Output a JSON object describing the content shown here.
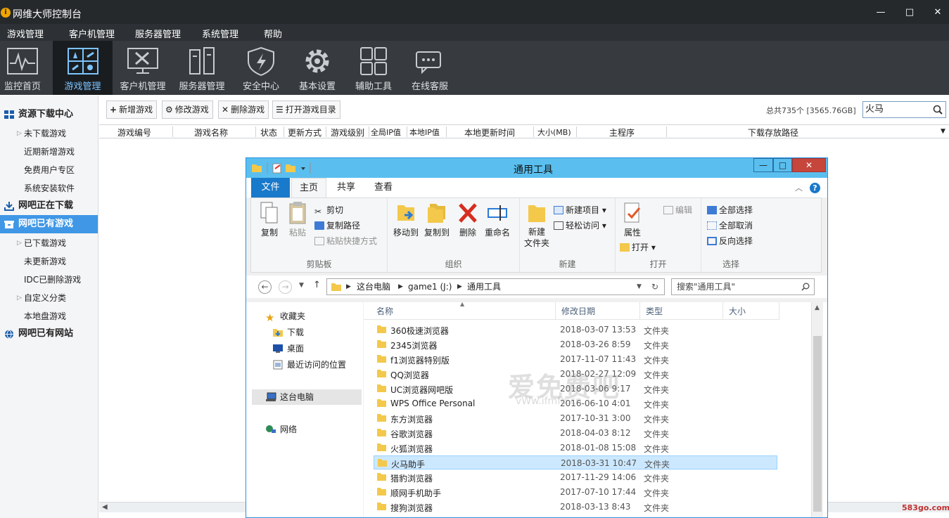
{
  "app": {
    "title": "网维大师控制台",
    "window_buttons": [
      "—",
      "□",
      "✕"
    ]
  },
  "menu": [
    "游戏管理",
    "客户机管理",
    "服务器管理",
    "系统管理",
    "帮助"
  ],
  "toolbar": [
    {
      "label": "监控首页",
      "icon": "monitor-pulse-icon"
    },
    {
      "label": "游戏管理",
      "icon": "game-pieces-icon",
      "active": true
    },
    {
      "label": "客户机管理",
      "icon": "client-tools-icon"
    },
    {
      "label": "服务器管理",
      "icon": "server-rack-icon"
    },
    {
      "label": "安全中心",
      "icon": "shield-icon"
    },
    {
      "label": "基本设置",
      "icon": "gear-icon"
    },
    {
      "label": "辅助工具",
      "icon": "grid-tools-icon"
    },
    {
      "label": "在线客服",
      "icon": "chat-icon"
    }
  ],
  "sidebar": {
    "items": [
      {
        "label": "资源下载中心",
        "group": true,
        "icon": "grid-icon"
      },
      {
        "label": "未下载游戏",
        "arrow": true
      },
      {
        "label": "近期新增游戏"
      },
      {
        "label": "免费用户专区"
      },
      {
        "label": "系统安装软件"
      },
      {
        "label": "网吧正在下载",
        "group": true,
        "icon": "download-icon"
      },
      {
        "label": "网吧已有游戏",
        "group": true,
        "icon": "box-icon",
        "selected": true
      },
      {
        "label": "已下载游戏",
        "arrow": true
      },
      {
        "label": "未更新游戏"
      },
      {
        "label": "IDC已删除游戏"
      },
      {
        "label": "自定义分类",
        "arrow": true
      },
      {
        "label": "本地盘游戏"
      },
      {
        "label": "网吧已有网站",
        "group": true,
        "icon": "globe-icon"
      }
    ]
  },
  "actions": {
    "add": "新增游戏",
    "edit": "修改游戏",
    "delete": "删除游戏",
    "open_dir": "打开游戏目录"
  },
  "summary": "总共735个 [3565.76GB]",
  "search": {
    "value": "火马"
  },
  "columns": [
    "游戏编号",
    "游戏名称",
    "状态",
    "更新方式",
    "游戏级别",
    "全局IP值",
    "本地IP值",
    "本地更新时间",
    "大小(MB)",
    "主程序",
    "下载存放路径"
  ],
  "explorer": {
    "title": "通用工具",
    "tabs": [
      "文件",
      "主页",
      "共享",
      "查看"
    ],
    "ribbon": {
      "clipboard": {
        "label": "剪贴板",
        "copy": "复制",
        "paste": "粘贴",
        "cut": "剪切",
        "copy_path": "复制路径",
        "paste_shortcut": "粘贴快捷方式"
      },
      "organize": {
        "label": "组织",
        "move_to": "移动到",
        "copy_to": "复制到",
        "delete": "删除",
        "rename": "重命名"
      },
      "new": {
        "label": "新建",
        "new_folder": "新建\n文件夹",
        "new_item": "新建项目",
        "easy_access": "轻松访问"
      },
      "open": {
        "label": "打开",
        "properties": "属性",
        "open": "打开",
        "edit": "编辑"
      },
      "select": {
        "label": "选择",
        "select_all": "全部选择",
        "select_none": "全部取消",
        "invert": "反向选择"
      }
    },
    "address": [
      "这台电脑",
      "game1 (J:)",
      "通用工具"
    ],
    "search_placeholder": "搜索\"通用工具\"",
    "nav": [
      {
        "label": "收藏夹",
        "icon": "star-icon"
      },
      {
        "label": "下载",
        "icon": "download-folder-icon"
      },
      {
        "label": "桌面",
        "icon": "desktop-icon"
      },
      {
        "label": "最近访问的位置",
        "icon": "recent-icon"
      },
      {
        "label": "这台电脑",
        "icon": "computer-icon",
        "selected": true
      },
      {
        "label": "网络",
        "icon": "network-icon"
      }
    ],
    "file_columns": [
      "名称",
      "修改日期",
      "类型",
      "大小"
    ],
    "files": [
      {
        "name": "360极速浏览器",
        "date": "2018-03-07 13:53",
        "type": "文件夹"
      },
      {
        "name": "2345浏览器",
        "date": "2018-03-26 8:59",
        "type": "文件夹"
      },
      {
        "name": "f1浏览器特别版",
        "date": "2017-11-07 11:43",
        "type": "文件夹"
      },
      {
        "name": "QQ浏览器",
        "date": "2018-02-27 12:09",
        "type": "文件夹"
      },
      {
        "name": "UC浏览器网吧版",
        "date": "2018-03-06 9:17",
        "type": "文件夹"
      },
      {
        "name": "WPS Office Personal",
        "date": "2016-06-10 4:01",
        "type": "文件夹"
      },
      {
        "name": "东方浏览器",
        "date": "2017-10-31 3:00",
        "type": "文件夹"
      },
      {
        "name": "谷歌浏览器",
        "date": "2018-04-03 8:12",
        "type": "文件夹"
      },
      {
        "name": "火狐浏览器",
        "date": "2018-01-08 15:08",
        "type": "文件夹"
      },
      {
        "name": "火马助手",
        "date": "2018-03-31 10:47",
        "type": "文件夹",
        "selected": true
      },
      {
        "name": "猎豹浏览器",
        "date": "2017-11-29 14:06",
        "type": "文件夹"
      },
      {
        "name": "顺网手机助手",
        "date": "2017-07-10 17:44",
        "type": "文件夹"
      },
      {
        "name": "搜狗浏览器",
        "date": "2018-03-13 8:43",
        "type": "文件夹"
      }
    ]
  },
  "watermark": {
    "text": "爱免费吧",
    "url": "vWw.ifmfb.cn"
  },
  "site_badge": "583go.com",
  "colors": {
    "accent": "#3f97e6",
    "titlebar": "#26292c",
    "toolbar": "#373b3f",
    "explorer_title": "#5abfef"
  }
}
